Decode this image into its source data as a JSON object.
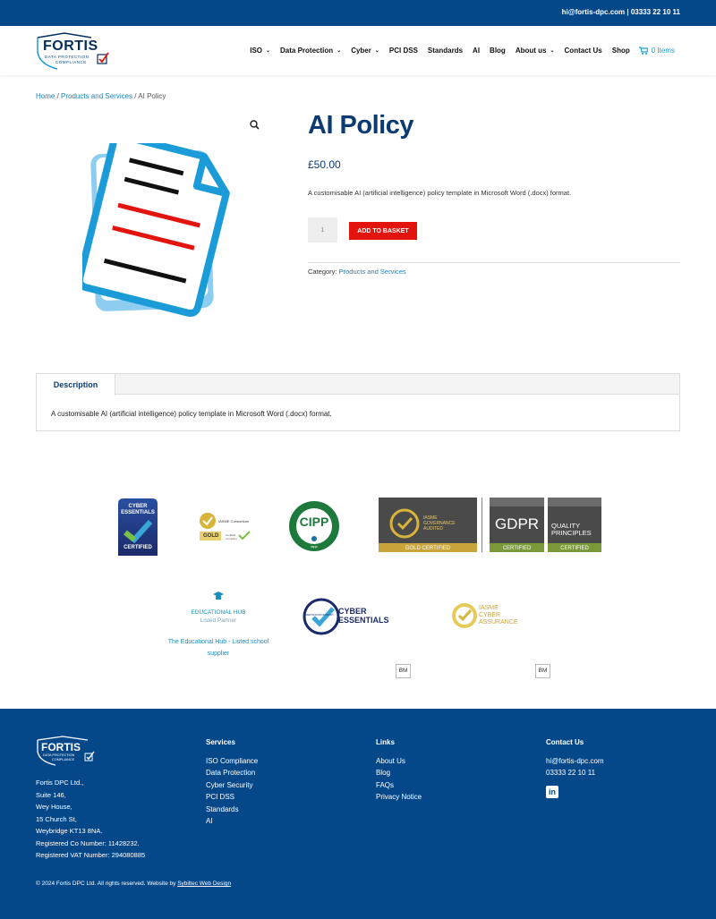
{
  "topbar": {
    "contact": "hi@fortis-dpc.com | 03333 22 10 11"
  },
  "logo": {
    "brand": "FORTIS",
    "tagline_1": "DATA PROTECTION",
    "tagline_2": "COMPLIANCE"
  },
  "nav": {
    "items": [
      {
        "label": "ISO",
        "has_dropdown": true
      },
      {
        "label": "Data Protection",
        "has_dropdown": true
      },
      {
        "label": "Cyber",
        "has_dropdown": true
      },
      {
        "label": "PCI DSS",
        "has_dropdown": false
      },
      {
        "label": "Standards",
        "has_dropdown": false
      },
      {
        "label": "AI",
        "has_dropdown": false
      },
      {
        "label": "Blog",
        "has_dropdown": false
      },
      {
        "label": "About us",
        "has_dropdown": true
      },
      {
        "label": "Contact Us",
        "has_dropdown": false
      },
      {
        "label": "Shop",
        "has_dropdown": false
      }
    ],
    "cart_label": "0 Items",
    "cart_icon": "shopping-cart-icon"
  },
  "breadcrumb": {
    "home": "Home",
    "category": "Products and Services",
    "current": "AI Policy",
    "separator": " / "
  },
  "product": {
    "title": "AI Policy",
    "price": "£50.00",
    "short_description": "A customisable AI (artificial intelligence) policy template in Microsoft Word (.docx) format.",
    "quantity": "1",
    "add_to_basket": "ADD TO BASKET",
    "category_label": "Category:",
    "category_link": "Products and Services",
    "zoom_icon": "magnifier-icon",
    "image_icon": "document-icon"
  },
  "tabs": {
    "items": [
      {
        "label": "Description"
      }
    ],
    "content": "A customisable AI (artificial intelligence) policy template in Microsoft Word (.docx) format."
  },
  "badges": {
    "cyber_essentials_1": "CYBER",
    "cyber_essentials_2": "ESSENTIALS",
    "cyber_essentials_certified": "CERTIFIED",
    "iasme_consortium": "IASME Consortium",
    "iasme_gold": "GOLD",
    "iasme_certified": "Certified Company",
    "cipp": "CIPP",
    "iapp": "iapp",
    "governance_1": "IASME",
    "governance_2": "GOVERNANCE",
    "governance_3": "AUDITED",
    "gold_certified": "GOLD CERTIFIED",
    "gdpr": "GDPR",
    "gdpr_certified": "CERTIFIED",
    "quality_1": "QUALITY",
    "quality_2": "PRINCIPLES",
    "quality_certified": "CERTIFIED",
    "edu_hub_1": "EDUCATIONAL HUB",
    "edu_hub_2": "Listed Partner",
    "edu_hub_caption": "The Educational Hub - Listed school supplier",
    "ce_body_1": "CYBER",
    "ce_body_2": "ESSENTIALS",
    "ce_body_ring": "CERTIFICATION BODY",
    "iasme_cyber_1": "IASME",
    "iasme_cyber_2": "CYBER",
    "iasme_cyber_3": "ASSURANCE",
    "bm_1": "BM",
    "bm_2": "BM"
  },
  "footer": {
    "address": [
      "Fortis DPC Ltd.,",
      "Suite 146,",
      "Wey House,",
      "15 Church St,",
      "Weybridge KT13 8NA.",
      "Registered Co Number: 11428232.",
      "Registered VAT Number: 294080885"
    ],
    "services_title": "Services",
    "services": [
      "ISO Compliance",
      "Data Protection",
      "Cyber Security",
      "PCI DSS",
      "Standards",
      "AI"
    ],
    "links_title": "Links",
    "links": [
      "About Us",
      "Blog",
      "FAQs",
      "Privacy Notice"
    ],
    "contact_title": "Contact Us",
    "contact": [
      "hi@fortis-dpc.com",
      "03333 22 10 11"
    ],
    "linkedin": "in",
    "copyright": "© 2024 Fortis DPC Ltd. All rights reserved. Website by",
    "copyright_link": "Sybiltec Web Design"
  }
}
